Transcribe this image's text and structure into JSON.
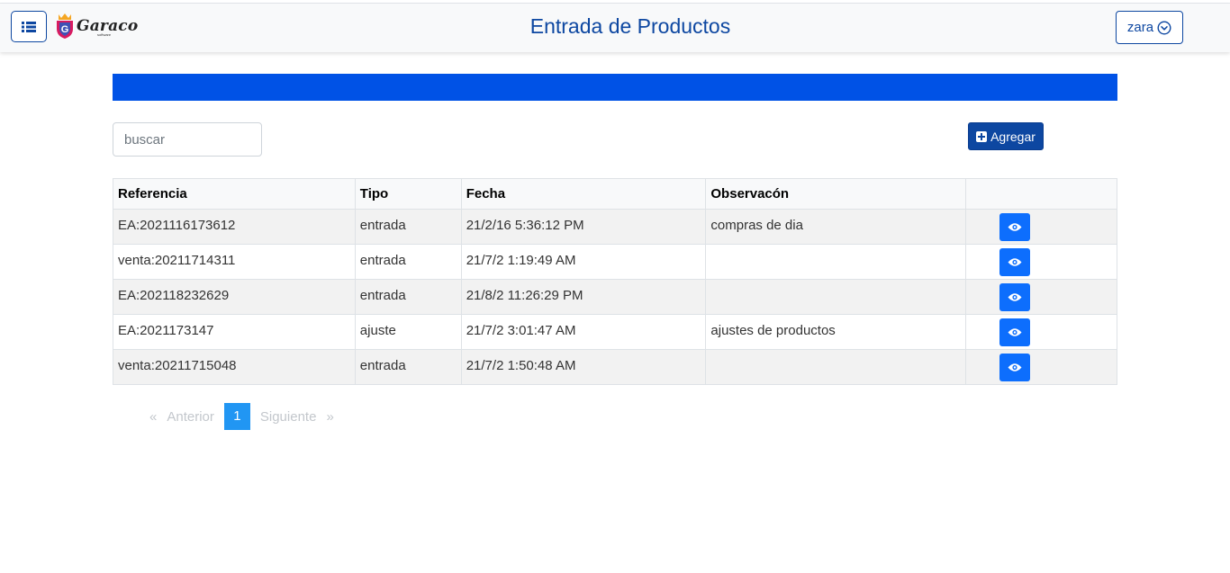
{
  "header": {
    "brand": "Garaco",
    "brand_sub": "software",
    "title": "Entrada de Productos",
    "user": "zara"
  },
  "toolbar": {
    "search_placeholder": "buscar",
    "add_label": "Agregar"
  },
  "table": {
    "columns": [
      "Referencia",
      "Tipo",
      "Fecha",
      "Observacón",
      ""
    ],
    "rows": [
      {
        "referencia": "EA:2021116173612",
        "tipo": "entrada",
        "fecha": "21/2/16 5:36:12 PM",
        "observacion": "compras de dia"
      },
      {
        "referencia": "venta:20211714311",
        "tipo": "entrada",
        "fecha": "21/7/2 1:19:49 AM",
        "observacion": ""
      },
      {
        "referencia": "EA:202118232629",
        "tipo": "entrada",
        "fecha": "21/8/2 11:26:29 PM",
        "observacion": ""
      },
      {
        "referencia": "EA:2021173147",
        "tipo": "ajuste",
        "fecha": "21/7/2 3:01:47 AM",
        "observacion": "ajustes de productos"
      },
      {
        "referencia": "venta:20211715048",
        "tipo": "entrada",
        "fecha": "21/7/2 1:50:48 AM",
        "observacion": ""
      }
    ]
  },
  "pagination": {
    "first": "«",
    "prev": "Anterior",
    "current": "1",
    "next": "Siguiente",
    "last": "»"
  },
  "colors": {
    "primary": "#0d47a1",
    "banner": "#0052e6",
    "view_button": "#0d6efd",
    "page_active": "#2196f3"
  },
  "icons": {
    "menu": "list-icon",
    "user_dropdown": "chevron-down-circle-icon",
    "add": "plus-square-icon",
    "view": "eye-icon"
  }
}
